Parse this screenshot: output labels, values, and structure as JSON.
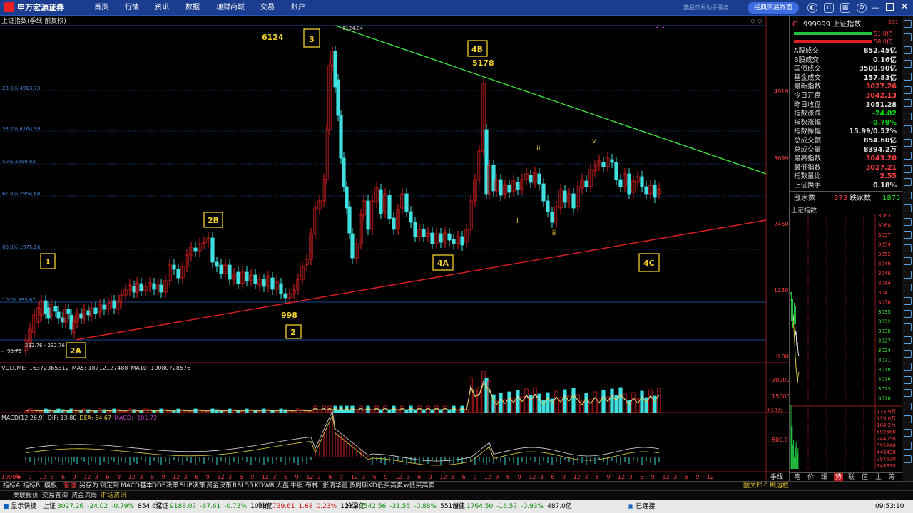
{
  "app": {
    "logo": "申万宏源证券",
    "nav": [
      "首页",
      "行情",
      "资讯",
      "数据",
      "理财商城",
      "交易",
      "账户"
    ],
    "faint_text": "选股交易助手服务",
    "classic_btn": "经典交易界面"
  },
  "chart": {
    "title": "上证指数(季线 前复权)",
    "peak_label": "6124.04",
    "low_label": "292.76 - 292.76",
    "start_label": "95.79",
    "fib_labels": [
      "23.6% 4913.73",
      "38.2% 4164.99",
      "50% 3559.83",
      "61.8% 2954.68",
      "80.9% 1975.16",
      "100% 995.67"
    ],
    "y_labels": [
      "4919",
      "3699",
      "2460",
      "1230",
      "0.00"
    ],
    "wave_labels": [
      "6124",
      "3",
      "4B",
      "5178",
      "2B",
      "1",
      "998",
      "2",
      "2A",
      "4A",
      "4C",
      "i",
      "ii",
      "iii",
      "iv"
    ],
    "volume_info": {
      "label": "VOLUME: 16372365312",
      "ma5": "MA5: 18712127488",
      "ma10": "MA10: 19080728576"
    },
    "vol_y": [
      "30000",
      "15000",
      "X10万"
    ],
    "macd_info": {
      "label": "MACD(12,26,9)",
      "dif": "DIF: 13.80",
      "dea": "DEA: 64.67",
      "macd": "MACD: -101.72"
    },
    "macd_y": [
      "500.0"
    ],
    "x_axis": [
      "1990年",
      "6",
      "9",
      "12",
      "3",
      "6",
      "9",
      "12",
      "3",
      "6",
      "9",
      "12",
      "3",
      "6",
      "9",
      "12",
      "3",
      "6",
      "9",
      "12",
      "3",
      "6",
      "9",
      "12",
      "3",
      "6",
      "9",
      "12",
      "3",
      "6",
      "9",
      "12",
      "3",
      "6",
      "9",
      "12",
      "3",
      "6",
      "9",
      "12",
      "3",
      "6",
      "9",
      "12",
      "3",
      "6",
      "9",
      "12",
      "3",
      "6",
      "9",
      "12",
      "3",
      "6",
      "9",
      "12",
      "3",
      "6",
      "9",
      "12",
      "3",
      "6",
      "9",
      "12"
    ],
    "period": "季线"
  },
  "right_panel": {
    "code": "999999",
    "name": "上证指数",
    "tag": "SG1",
    "up_val": "51.0亿",
    "down_val": "58.0亿",
    "stats": [
      {
        "label": "A股成交",
        "value": "852.45亿",
        "color": "#e0e0e0"
      },
      {
        "label": "B股成交",
        "value": "0.16亿",
        "color": "#e0e0e0"
      },
      {
        "label": "国债成交",
        "value": "3500.90亿",
        "color": "#e0e0e0"
      },
      {
        "label": "基金成交",
        "value": "157.83亿",
        "color": "#e0e0e0"
      },
      {
        "label": "最新指数",
        "value": "3027.26",
        "color": "#ff4040"
      },
      {
        "label": "今日开盘",
        "value": "3042.13",
        "color": "#ff4040"
      },
      {
        "label": "昨日收盘",
        "value": "3051.28",
        "color": "#e0e0e0"
      },
      {
        "label": "指数涨跌",
        "value": "-24.02",
        "color": "#00e000"
      },
      {
        "label": "指数涨幅",
        "value": "-0.79%",
        "color": "#00e000"
      },
      {
        "label": "指数振幅",
        "value": "15.99/0.52%",
        "color": "#e0e0e0"
      },
      {
        "label": "总成交额",
        "value": "854.60亿",
        "color": "#e0e0e0"
      },
      {
        "label": "总成交量",
        "value": "8394.2万",
        "color": "#e0e0e0"
      },
      {
        "label": "最高指数",
        "value": "3043.20",
        "color": "#ff4040"
      },
      {
        "label": "最低指数",
        "value": "3027.21",
        "color": "#ff4040"
      },
      {
        "label": "指数量比",
        "value": "2.55",
        "color": "#ff4040"
      },
      {
        "label": "上证换手",
        "value": "0.18%",
        "color": "#e0e0e0"
      }
    ],
    "rise_label": "涨家数",
    "rise": "373",
    "fall_label": "跌家数",
    "fall": "1875",
    "mini_title": "上证指数",
    "mini_y": [
      "3063",
      "3060",
      "3057",
      "3054",
      "3052",
      "3049",
      "3046",
      "3044",
      "3041",
      "3038",
      "3035",
      "3032",
      "3030",
      "3027",
      "3024",
      "3021",
      "3018",
      "3016",
      "3013",
      "3010"
    ],
    "mini_vol_y": [
      "133.9万",
      "119.0万",
      "104.2万",
      "892680",
      "744050",
      "595240",
      "446430",
      "297620",
      "148810"
    ],
    "bottom_tabs": [
      "笔",
      "价",
      "细",
      "势",
      "联",
      "值",
      "主",
      "筹"
    ]
  },
  "tabs1": [
    "指标A",
    "指标B",
    "模板",
    "管理",
    "另存为",
    "锁定到",
    "MACD基本",
    "DDE决策",
    "SUP决策",
    "资金决策",
    "RSI 55",
    "KDWR",
    "大盘",
    "牛股",
    "布林",
    "张清华量",
    "多周期KD",
    "低买高卖",
    "w低买高卖"
  ],
  "tabs1_right": [
    "图文F10",
    "刷边栏"
  ],
  "tabs2": [
    "关联报价",
    "交易查询",
    "资金流向",
    "市场资讯"
  ],
  "status": {
    "show": "显示快捷",
    "items": [
      {
        "label": "上证",
        "vals": [
          "3027.26",
          "-24.02",
          "-0.79%",
          "854.6亿"
        ]
      },
      {
        "label": "深证",
        "vals": [
          "9188.07",
          "-67.61",
          "-0.73%",
          "1038亿"
        ]
      },
      {
        "label": "科创",
        "vals": [
          "739.61",
          "1.68",
          "0.23%",
          "122.3亿"
        ]
      },
      {
        "label": "沪深",
        "vals": [
          "3542.56",
          "-31.55",
          "-0.88%",
          "551.9亿"
        ]
      },
      {
        "label": "创业",
        "vals": [
          "1764.50",
          "-16.57",
          "-0.93%",
          "487.0亿"
        ]
      }
    ],
    "conn": "已连接",
    "time": "09:53:10"
  }
}
